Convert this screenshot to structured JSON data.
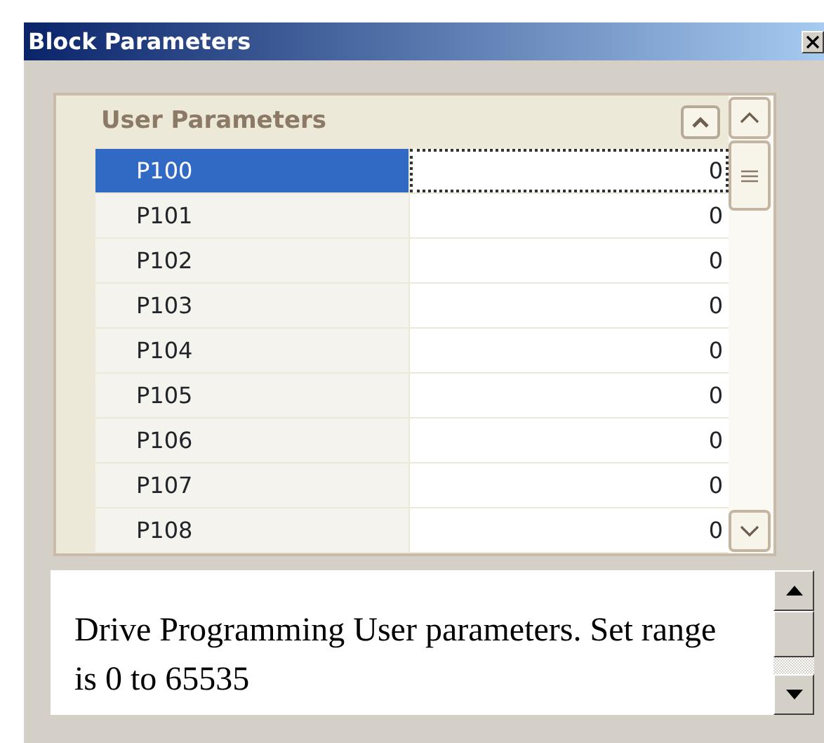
{
  "window": {
    "title": "Block Parameters"
  },
  "category": {
    "label": "User Parameters",
    "expanded": true
  },
  "rows": [
    {
      "name": "P100",
      "value": "0",
      "selected": true
    },
    {
      "name": "P101",
      "value": "0",
      "selected": false
    },
    {
      "name": "P102",
      "value": "0",
      "selected": false
    },
    {
      "name": "P103",
      "value": "0",
      "selected": false
    },
    {
      "name": "P104",
      "value": "0",
      "selected": false
    },
    {
      "name": "P105",
      "value": "0",
      "selected": false
    },
    {
      "name": "P106",
      "value": "0",
      "selected": false
    },
    {
      "name": "P107",
      "value": "0",
      "selected": false
    },
    {
      "name": "P108",
      "value": "0",
      "selected": false
    }
  ],
  "description": "Drive Programming User parameters. Set range is 0 to 65535"
}
